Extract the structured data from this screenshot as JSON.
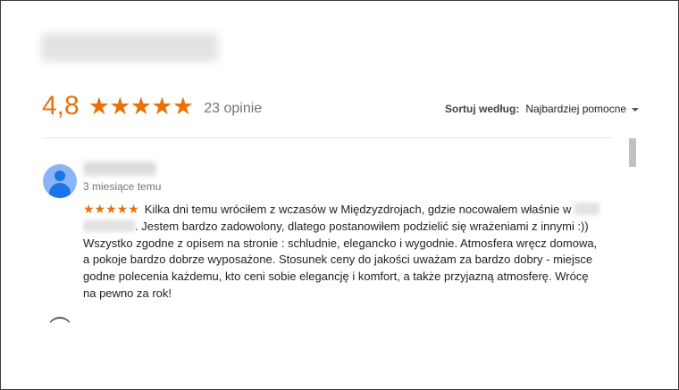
{
  "summary": {
    "rating": "4,8",
    "stars": "★★★★★",
    "count_text": "23 opinie"
  },
  "sort": {
    "label": "Sortuj według:",
    "value": "Najbardziej pomocne"
  },
  "review": {
    "time": "3 miesiące temu",
    "stars": "★★★★★",
    "text_part1": "Kilka dni temu wróciłem z wczasów w Międzyzdrojach, gdzie nocowałem właśnie w",
    "text_part2": ". Jestem bardzo zadowolony, dlatego postanowiłem podzielić się wrażeniami z innymi :)) Wszystko zgodne z opisem na stronie : schludnie, elegancko i wygodnie. Atmosfera wręcz domowa, a pokoje bardzo dobrze wyposażone. Stosunek ceny do jakości uważam za bardzo dobry - miejsce godne polecenia każdemu, kto ceni sobie elegancję i komfort, a także przyjazną atmosferę. Wrócę na pewno za rok!"
  },
  "colors": {
    "accent": "#e8710a",
    "avatar_bg": "#8ab4f8",
    "avatar_fg": "#1a73e8"
  }
}
